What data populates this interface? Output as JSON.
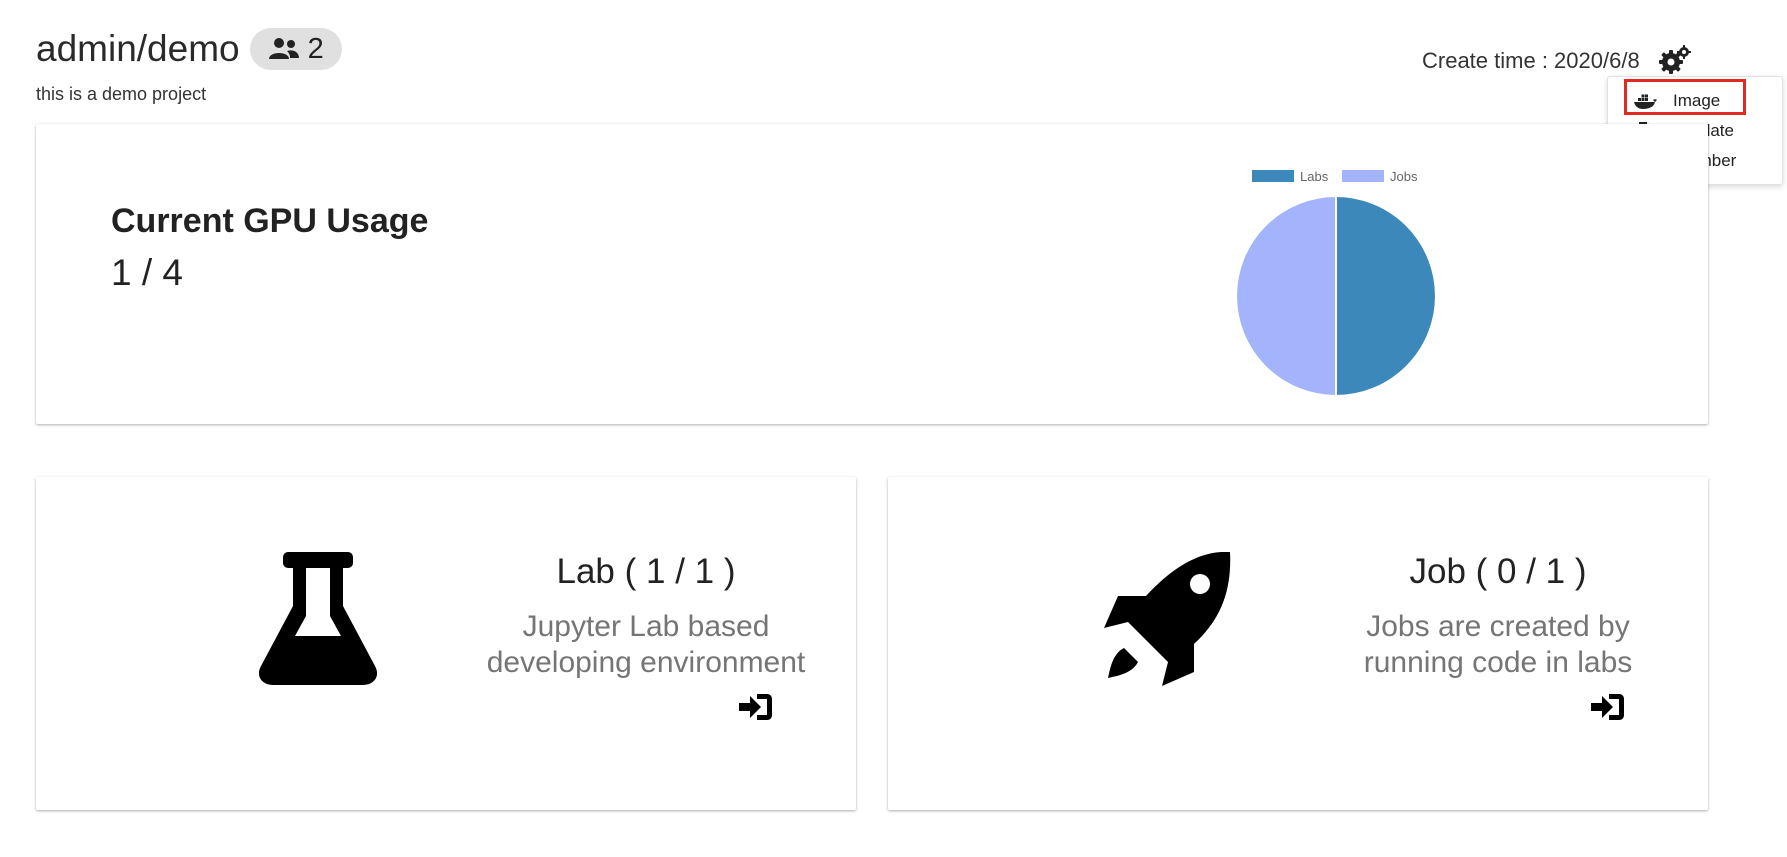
{
  "project": {
    "name": "admin/demo",
    "member_count": "2",
    "description": "this is a demo project",
    "create_time": "Create time : 2020/6/8"
  },
  "settings_menu": {
    "items": [
      {
        "label": "Image",
        "icon": "docker-icon",
        "highlighted": true
      },
      {
        "label": "Template",
        "icon": "file-code-icon"
      },
      {
        "label": "Member",
        "icon": "users-icon"
      }
    ],
    "highlight_color": "#e12b22"
  },
  "gpu": {
    "title": "Current GPU Usage",
    "value": "1 / 4"
  },
  "chart_data": {
    "type": "pie",
    "categories": [
      "Labs",
      "Jobs"
    ],
    "values": [
      1,
      1
    ],
    "colors": [
      "#3d88bb",
      "#a3b4fc"
    ],
    "legend": "top"
  },
  "lab": {
    "title": "Lab ( 1 / 1 )",
    "desc_line1": "Jupyter Lab based",
    "desc_line2": "developing environment",
    "icon": "flask-icon"
  },
  "job": {
    "title": "Job ( 0 / 1 )",
    "desc_line1": "Jobs are created by",
    "desc_line2": "running code in labs",
    "icon": "rocket-icon"
  }
}
